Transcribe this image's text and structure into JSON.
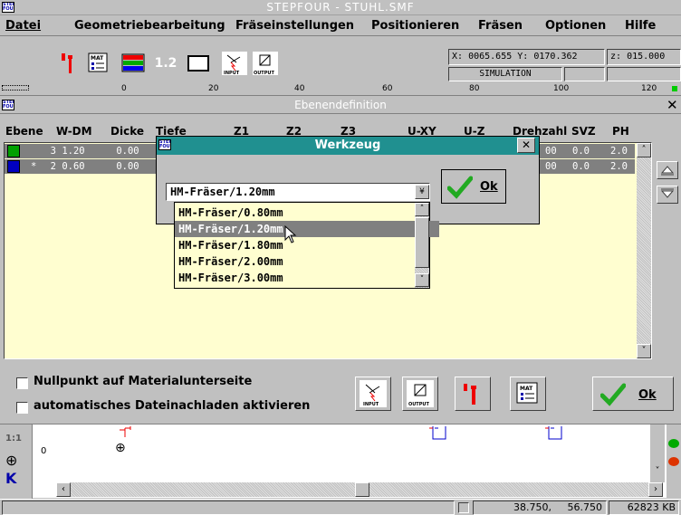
{
  "app": {
    "title": "STEPFOUR - STUHL.SMF",
    "logo_text": "STEP FOUR"
  },
  "menu": [
    "Datei",
    "Geometriebearbeitung",
    "Fräseinstellungen",
    "Positionieren",
    "Fräsen",
    "Optionen",
    "Hilfe"
  ],
  "toolbar": {
    "value_12": "1.2",
    "input_label": "INPUT",
    "output_label": "OUTPUT",
    "mat_label": "MAT"
  },
  "coords": {
    "x_label": "X:",
    "x_value": "0065.655",
    "y_label": "Y:",
    "y_value": "0170.362",
    "z_label": "z:",
    "z_value": "015.000",
    "mode": "SIMULATION"
  },
  "ruler": {
    "ticks": [
      "0",
      "20",
      "40",
      "60",
      "80",
      "100",
      "120"
    ]
  },
  "ebenen": {
    "title": "Ebenendefinition",
    "columns": [
      "Ebene",
      "W-DM",
      "Dicke",
      "Tiefe",
      "Z1",
      "Z2",
      "Z3",
      "U-XY",
      "U-Z",
      "Drehzahl",
      "SVZ",
      "PH"
    ],
    "rows": [
      {
        "marker": "",
        "num": "3",
        "wdm": "1.20",
        "dicke": "0.00",
        "drehzahl": "00",
        "svz": "0.0",
        "ph": "2.0",
        "color": "#00a000"
      },
      {
        "marker": "*",
        "num": "2",
        "wdm": "0.60",
        "dicke": "0.00",
        "drehzahl": "00",
        "svz": "0.0",
        "ph": "2.0",
        "color": "#0000c0"
      }
    ],
    "opt_nullpunkt": "Nullpunkt auf Materialunterseite",
    "opt_nachladen": "automatisches Dateinachladen aktivieren",
    "ok_label": "Ok"
  },
  "werkzeug": {
    "title": "Werkzeug",
    "selected": "HM-Fräser/1.20mm",
    "options": [
      "HM-Fräser/0.80mm",
      "HM-Fräser/1.20mm",
      "HM-Fräser/1.80mm",
      "HM-Fräser/2.00mm",
      "HM-Fräser/3.00mm"
    ],
    "highlighted_index": 1,
    "ok_label": "Ok"
  },
  "bottom": {
    "zero_label": "0",
    "k_label": "K",
    "ratio_label": "1:1"
  },
  "status": {
    "x": "38.750,",
    "y": "56.750",
    "memory": "62823 KB"
  },
  "colors": {
    "title_bar": "#c0c0c0",
    "dialog_title": "#209090",
    "list_bg": "#fffed0",
    "selection": "#808080",
    "ebene1": "#00a000",
    "ebene2": "#0000c0"
  }
}
